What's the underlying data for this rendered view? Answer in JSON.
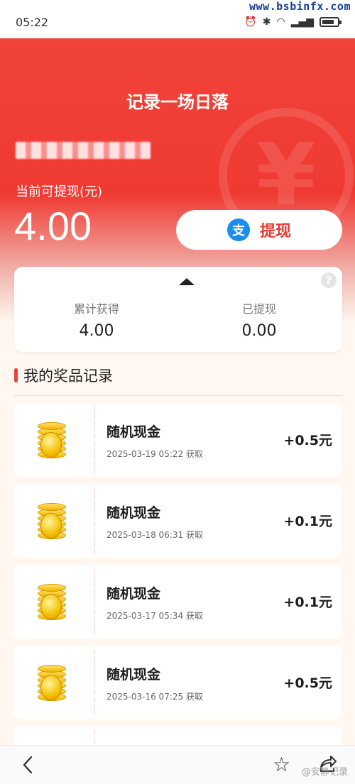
{
  "status_bar": {
    "time": "05:22",
    "watermark": "www.bsbinfx.com"
  },
  "header": {
    "title": "记录一场日落",
    "yen_symbol": "¥",
    "withdrawable_label": "当前可提现(元)",
    "balance": "4.00",
    "withdraw_button": {
      "icon_glyph": "支",
      "label": "提现"
    }
  },
  "stats": {
    "help_glyph": "?",
    "total_label": "累计获得",
    "total_value": "4.00",
    "withdrawn_label": "已提现",
    "withdrawn_value": "0.00"
  },
  "section": {
    "title": "我的奖品记录"
  },
  "rewards": [
    {
      "name": "随机现金",
      "date": "2025-03-19 05:22 获取",
      "amount": "+0.5元"
    },
    {
      "name": "随机现金",
      "date": "2025-03-18 06:31 获取",
      "amount": "+0.1元"
    },
    {
      "name": "随机现金",
      "date": "2025-03-17 05:34 获取",
      "amount": "+0.1元"
    },
    {
      "name": "随机现金",
      "date": "2025-03-16 07:25 获取",
      "amount": "+0.5元"
    }
  ],
  "bottom_bar": {
    "star_glyph": "☆",
    "watermark": "@安静记录"
  },
  "colors": {
    "accent_red": "#ef3a33",
    "alipay_blue": "#1a8ded",
    "background": "#fff7f0"
  },
  "icons": [
    "alarm-icon",
    "bluetooth-icon",
    "wifi-icon",
    "signal-icon",
    "battery-icon",
    "yen-icon",
    "alipay-icon",
    "help-icon",
    "coin-stack-icon",
    "back-arrow-icon",
    "star-icon",
    "share-icon"
  ]
}
